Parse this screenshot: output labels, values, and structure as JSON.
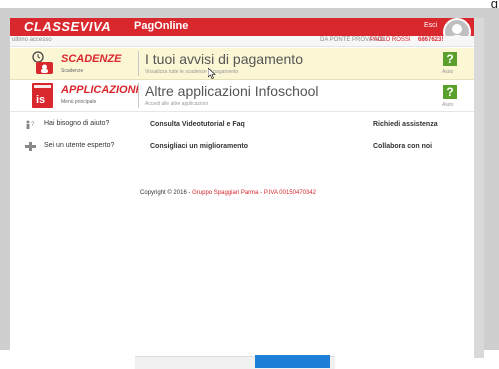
{
  "top_char": "g",
  "header": {
    "brand": "CLASSEVIVA",
    "product": "PagOnline",
    "logout": "Esci"
  },
  "subbar": {
    "last_access": "ultimo accesso",
    "school": "DA PONTE PROVA SIDI",
    "user": "PAOLO ROSSI",
    "user_id": "6867623!"
  },
  "menu": [
    {
      "title": "SCADENZE",
      "subtitle": "Scadenze",
      "main": "I tuoi avvisi di pagamento",
      "main_sub": "Visualizza tutte le scadenze di pagamento",
      "help": "?",
      "help_label": "Aiuto",
      "icon": "alarm-clock-icon"
    },
    {
      "title": "APPLICAZIONI",
      "subtitle": "Menù principale",
      "main": "Altre applicazioni Infoschool",
      "main_sub": "Accedi alle altre applicazioni",
      "help": "?",
      "help_label": "Aiuto",
      "icon": "is-apps-icon"
    }
  ],
  "info": {
    "q1": "Hai bisogno di aiuto?",
    "q1_link": "Consulta Videotutorial e Faq",
    "q1_action": "Richiedi assistenza",
    "q2": "Sei un utente esperto?",
    "q2_link": "Consigliaci un miglioramento",
    "q2_action": "Collabora con noi"
  },
  "footer": {
    "copyright": "Copyright © 2016 -",
    "company": "Gruppo Spaggiari Parma",
    "vat": "- P.IVA 00150470342"
  },
  "colors": {
    "brand_red": "#d9272e",
    "help_green": "#5aa02c",
    "highlight_yellow": "#fbf6d4"
  }
}
